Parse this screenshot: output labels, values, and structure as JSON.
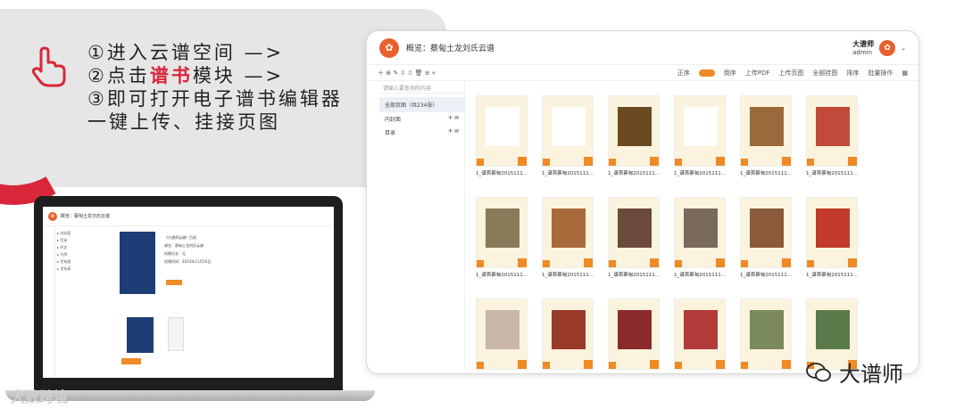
{
  "steps": {
    "line1": "①进入云谱空间 —>",
    "line2_pre": "②点击",
    "line2_hl": "谱书",
    "line2_post": "模块 —>",
    "line3": "③即可打开电子谱书编辑器",
    "line4": "一键上传、挂接页图"
  },
  "window": {
    "title": "概览：蔡甸土龙刘氏云谱",
    "user_name": "大谱师",
    "user_role": "admin"
  },
  "toolbar": {
    "items": [
      "正序",
      "倒序",
      "上传PDF",
      "上传页图",
      "全部挂图",
      "排序",
      "批量操作"
    ]
  },
  "sidebar": {
    "search_placeholder": "请输入要查询的内容",
    "all_label": "全部页图（共234张）",
    "items": [
      "内封面",
      "目录"
    ]
  },
  "grid": {
    "caption": "1_谱首蔡甸2015111..."
  },
  "laptop": {
    "title": "概览：蔡甸土龙刘氏云谱",
    "info": [
      "《大谱师云谱》目录",
      "谱名：蔡甸土龙刘氏云谱",
      "所属分支：无",
      "创建时间：2023年11月16日"
    ]
  },
  "watermark": "大数跨境",
  "brand": "大谱师",
  "colors": {
    "accent": "#f08a24",
    "red": "#d9263a"
  }
}
